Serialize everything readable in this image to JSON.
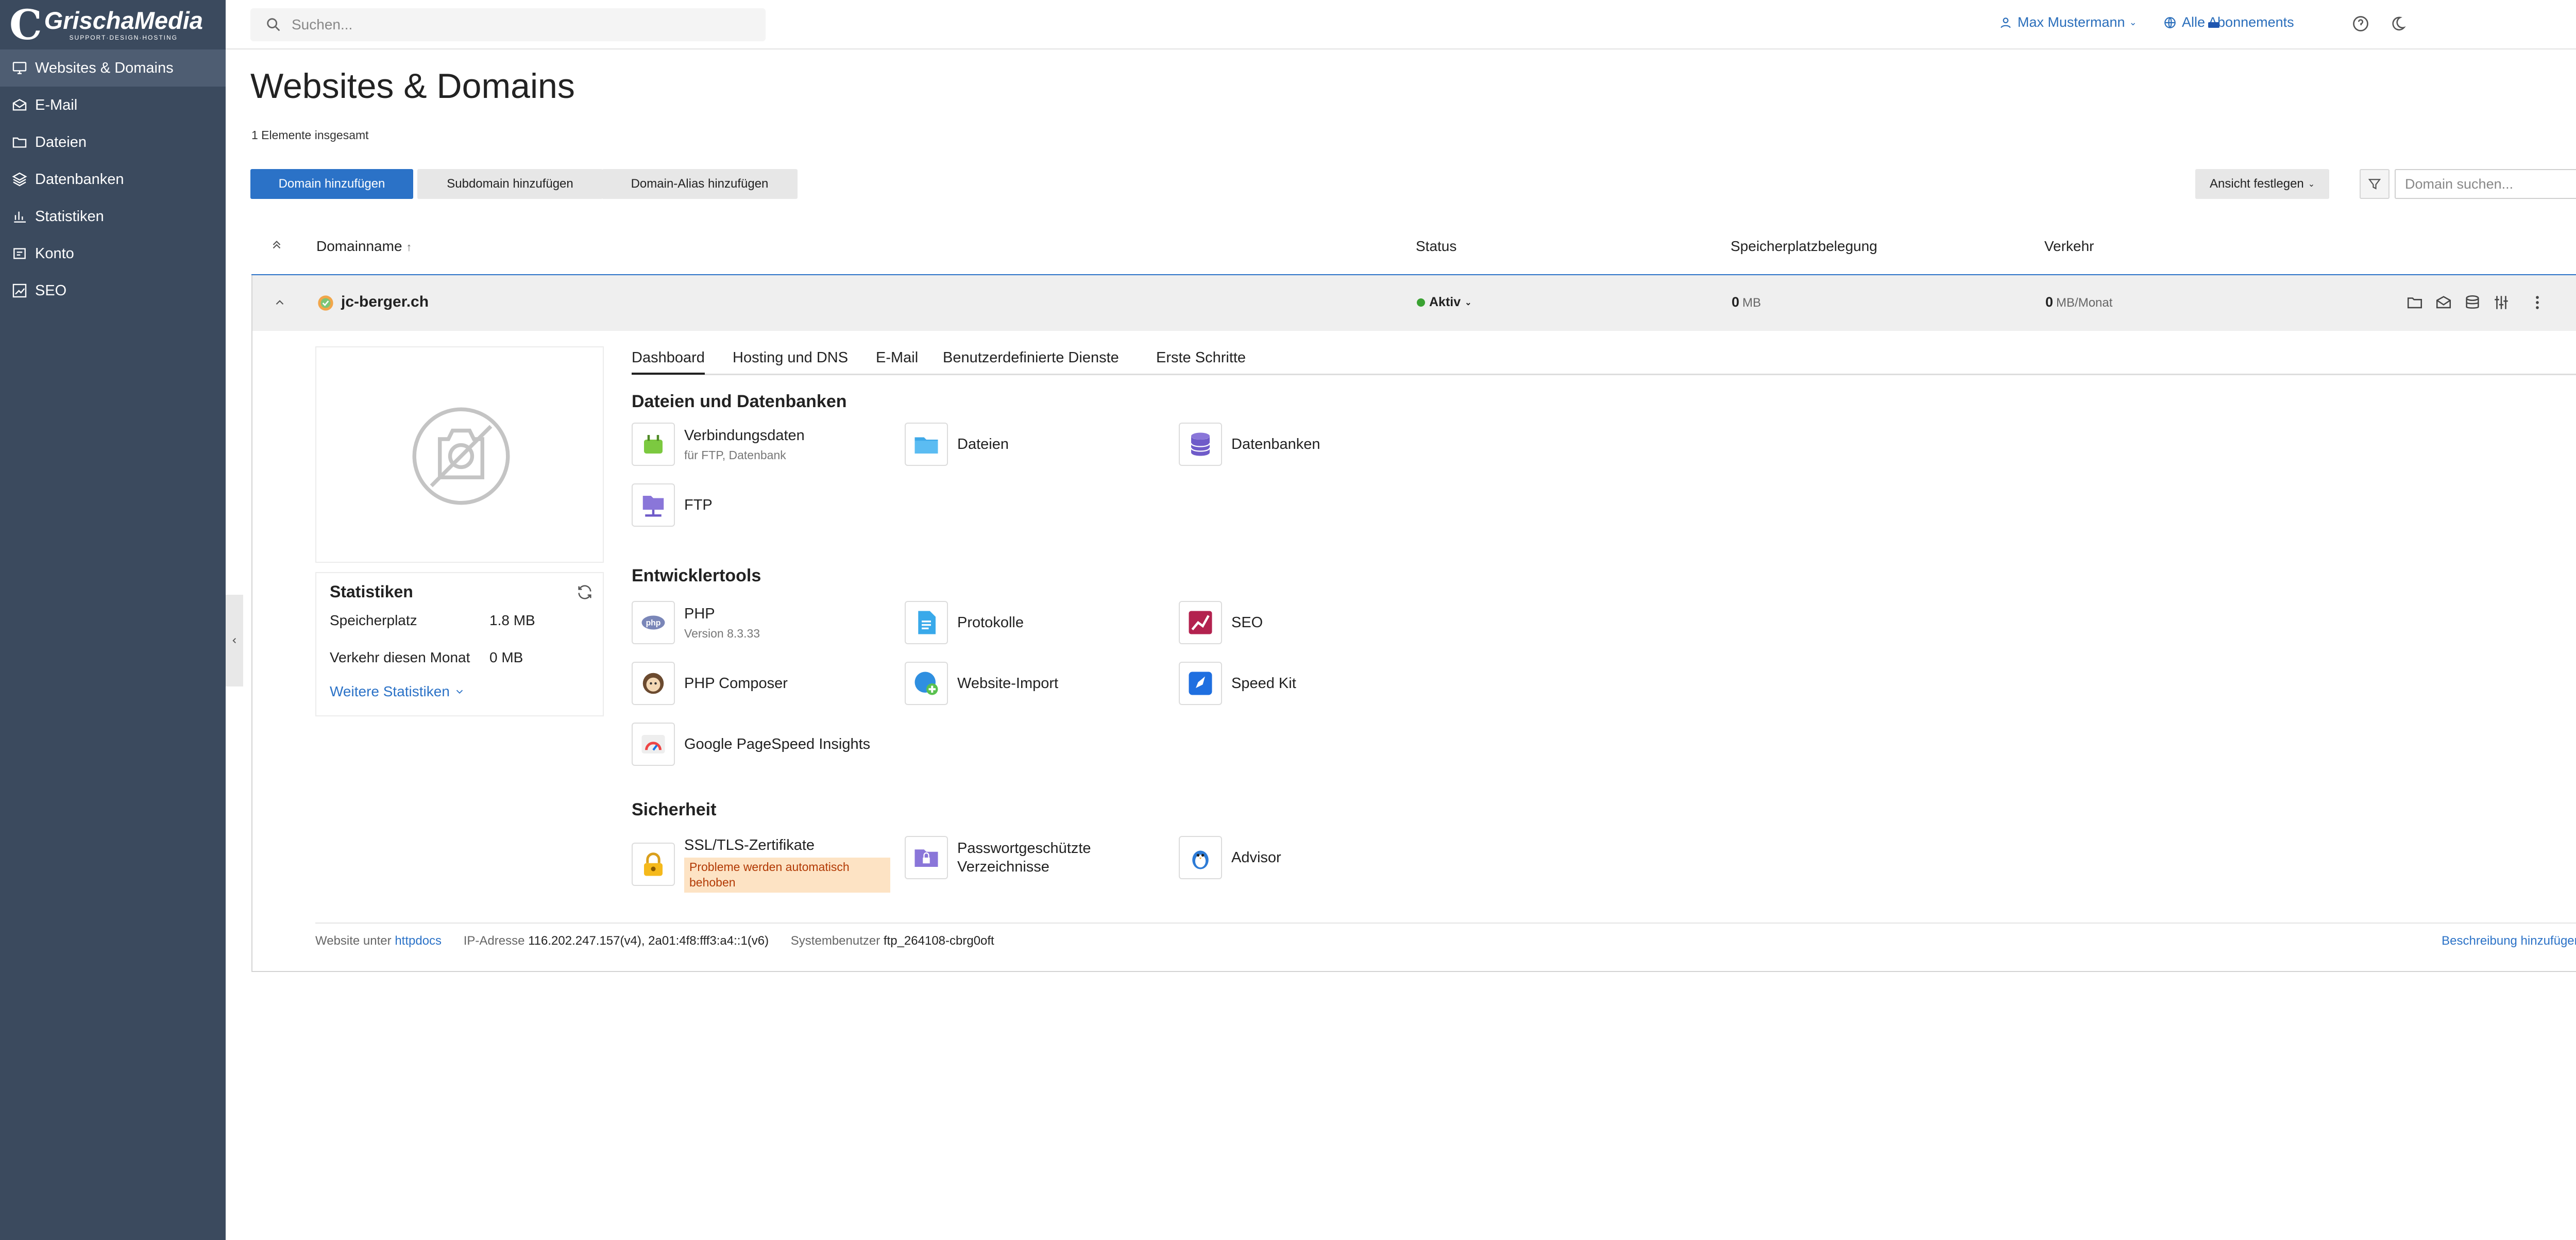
{
  "brand": {
    "logo_letter": "C",
    "name": "GrischaMedia",
    "tagline": "SUPPORT·DESIGN·HOSTING"
  },
  "sidebar": {
    "items": [
      {
        "label": "Websites & Domains",
        "icon": "monitor-icon",
        "active": true
      },
      {
        "label": "E-Mail",
        "icon": "mail-icon"
      },
      {
        "label": "Dateien",
        "icon": "folder-icon"
      },
      {
        "label": "Datenbanken",
        "icon": "database-icon"
      },
      {
        "label": "Statistiken",
        "icon": "bar-chart-icon"
      },
      {
        "label": "Konto",
        "icon": "account-icon"
      },
      {
        "label": "SEO",
        "icon": "seo-icon"
      }
    ]
  },
  "topbar": {
    "search_placeholder": "Suchen...",
    "user_name": "Max Mustermann",
    "subscriptions": "Alle Abonnements",
    "icons": [
      "help-icon",
      "moon-icon",
      "flag-icon"
    ]
  },
  "page": {
    "title": "Websites & Domains",
    "total_count": "1 Elemente insgesamt",
    "buttons": {
      "add_domain": "Domain hinzufügen",
      "add_subdomain": "Subdomain hinzufügen",
      "add_alias": "Domain-Alias hinzufügen",
      "view": "Ansicht festlegen"
    },
    "domain_search_placeholder": "Domain suchen..."
  },
  "table": {
    "headers": {
      "domain": "Domainname",
      "sort_indicator": "↑",
      "status": "Status",
      "storage": "Speicherplatzbelegung",
      "traffic": "Verkehr"
    },
    "row": {
      "domain": "jc-berger.ch",
      "status": "Aktiv",
      "storage_value": "0",
      "storage_unit": "MB",
      "traffic_value": "0",
      "traffic_unit": "MB/Monat"
    }
  },
  "stats": {
    "title": "Statistiken",
    "storage_label": "Speicherplatz",
    "storage_value": "1.8 MB",
    "traffic_label": "Verkehr diesen Monat",
    "traffic_value": "0 MB",
    "more": "Weitere Statistiken"
  },
  "tabs": [
    "Dashboard",
    "Hosting und DNS",
    "E-Mail",
    "Benutzerdefinierte Dienste",
    "Erste Schritte"
  ],
  "sections": {
    "files": {
      "title": "Dateien und Datenbanken",
      "tools": [
        {
          "name": "Verbindungsdaten",
          "sub": "für FTP, Datenbank",
          "icon": "plug-icon"
        },
        {
          "name": "Dateien",
          "icon": "folder-icon"
        },
        {
          "name": "Datenbanken",
          "icon": "database-icon"
        },
        {
          "name": "FTP",
          "icon": "ftp-icon"
        }
      ]
    },
    "dev": {
      "title": "Entwicklertools",
      "tools": [
        {
          "name": "PHP",
          "sub": "Version 8.3.33",
          "icon": "php-icon"
        },
        {
          "name": "Protokolle",
          "icon": "log-file-icon"
        },
        {
          "name": "SEO",
          "icon": "seo-icon"
        },
        {
          "name": "PHP Composer",
          "icon": "composer-icon"
        },
        {
          "name": "Website-Import",
          "icon": "globe-import-icon"
        },
        {
          "name": "Speed Kit",
          "icon": "rocket-icon"
        },
        {
          "name": "Google PageSpeed Insights",
          "icon": "gauge-icon"
        }
      ]
    },
    "security": {
      "title": "Sicherheit",
      "tools": [
        {
          "name": "SSL/TLS-Zertifikate",
          "warning": "Probleme werden automatisch behoben",
          "icon": "lock-icon"
        },
        {
          "name": "Passwortgeschützte Verzeichnisse",
          "icon": "locked-folder-icon"
        },
        {
          "name": "Advisor",
          "icon": "advisor-icon"
        }
      ]
    }
  },
  "footer": {
    "website_label": "Website unter",
    "website_value": "httpdocs",
    "ip_label": "IP-Adresse",
    "ip_value": "116.202.247.157(v4), 2a01:4f8:fff3:a4::1(v6)",
    "user_label": "Systembenutzer",
    "user_value": "ftp_264108-cbrg0oft",
    "add_description": "Beschreibung hinzufügen"
  },
  "colors": {
    "sidebar_bg": "#3b4a5e",
    "primary": "#2b72c7",
    "active_status": "#3aa232",
    "warning_bg": "#fde3c4",
    "warning_text": "#b23a05"
  }
}
